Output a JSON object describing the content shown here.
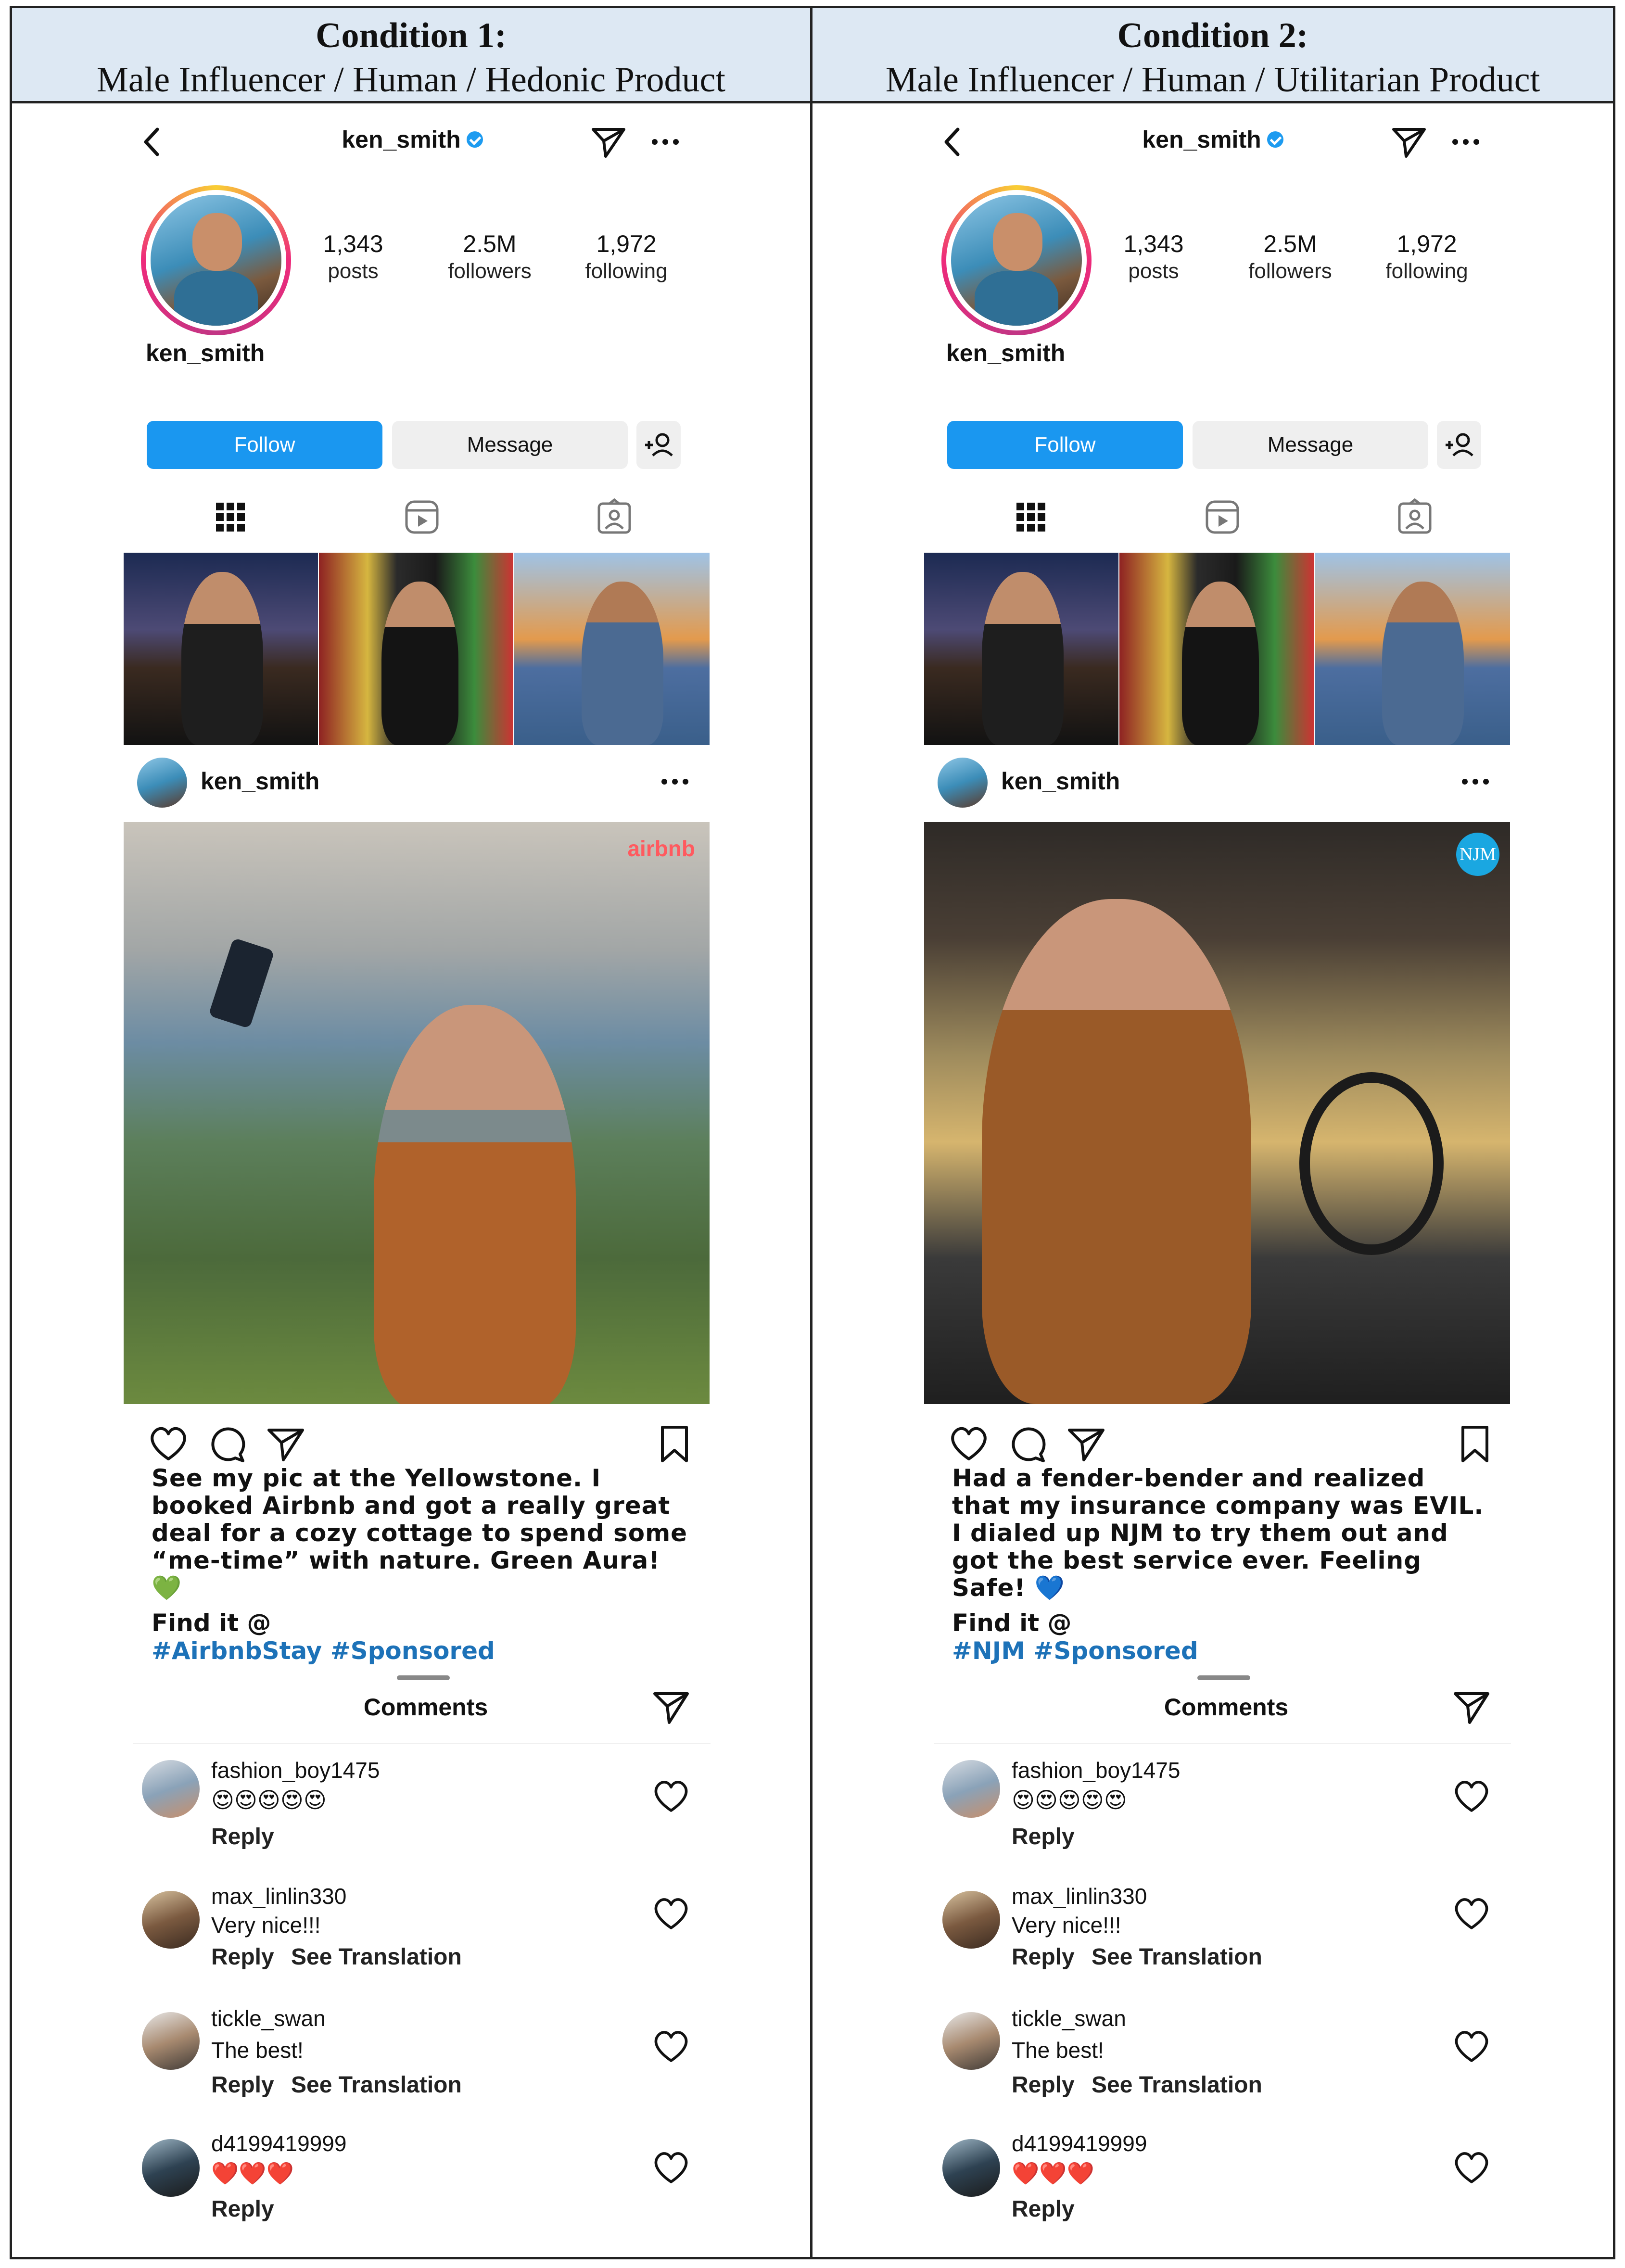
{
  "conditions": [
    {
      "title": "Condition 1:",
      "subtitle": "Male Influencer / Human / Hedonic Product",
      "brand_logo": "airbnb",
      "caption": "See my pic at the Yellowstone. I booked Airbnb and got a really great deal for a cozy cottage to spend some “me-time” with nature. Green Aura! 💚",
      "hashtags": "#AirbnbStay #Sponsored"
    },
    {
      "title": "Condition 2:",
      "subtitle": "Male Influencer / Human / Utilitarian Product",
      "brand_logo": "NJM",
      "caption": "Had a fender-bender and realized that my insurance company was EVIL. I dialed up NJM to try them out and got the best service ever. Feeling Safe! 💙",
      "hashtags": "#NJM #Sponsored"
    }
  ],
  "profile": {
    "username": "ken_smith",
    "posts_count": "1,343",
    "posts_label": "posts",
    "followers_count": "2.5M",
    "followers_label": "followers",
    "following_count": "1,972",
    "following_label": "following",
    "follow_label": "Follow",
    "message_label": "Message"
  },
  "post": {
    "find_label": "Find it @"
  },
  "comments": {
    "title": "Comments",
    "reply_label": "Reply",
    "translate_label": "See Translation",
    "items": [
      {
        "user": "fashion_boy1475",
        "text": "😍😍😍😍😍"
      },
      {
        "user": "max_linlin330",
        "text": "Very nice!!!"
      },
      {
        "user": "tickle_swan",
        "text": "The best!"
      },
      {
        "user": "d4199419999",
        "text": "❤️❤️❤️"
      }
    ]
  },
  "colors": {
    "follow_blue": "#1a97f0",
    "hashtag_blue": "#1d72b8",
    "header_bg": "#dde8f3",
    "airbnb_red": "#ff5a5f",
    "njm_blue": "#1aa7e1"
  },
  "icons": [
    "back-chevron-icon",
    "verified-badge-icon",
    "send-icon",
    "more-icon",
    "add-person-icon",
    "grid-icon",
    "reels-icon",
    "tagged-icon",
    "heart-icon",
    "comment-icon",
    "bookmark-icon"
  ]
}
